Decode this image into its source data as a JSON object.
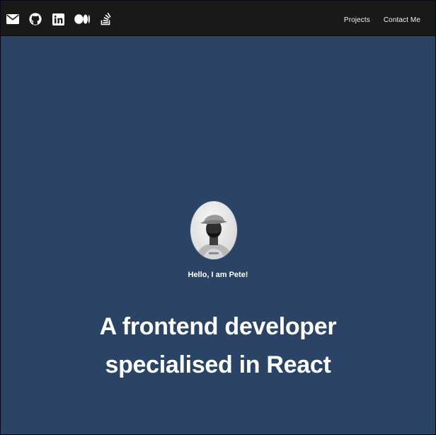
{
  "header": {
    "social_icons": [
      "envelope-icon",
      "github-icon",
      "linkedin-icon",
      "medium-icon",
      "stackoverflow-icon"
    ],
    "nav": {
      "projects_label": "Projects",
      "contact_label": "Contact Me"
    }
  },
  "hero": {
    "greeting": "Hello, I am Pete!",
    "headline_line1": "A frontend developer",
    "headline_line2": "specialised in React"
  },
  "colors": {
    "header_bg": "#191919",
    "page_bg": "#2b4466",
    "text": "#ffffff"
  }
}
